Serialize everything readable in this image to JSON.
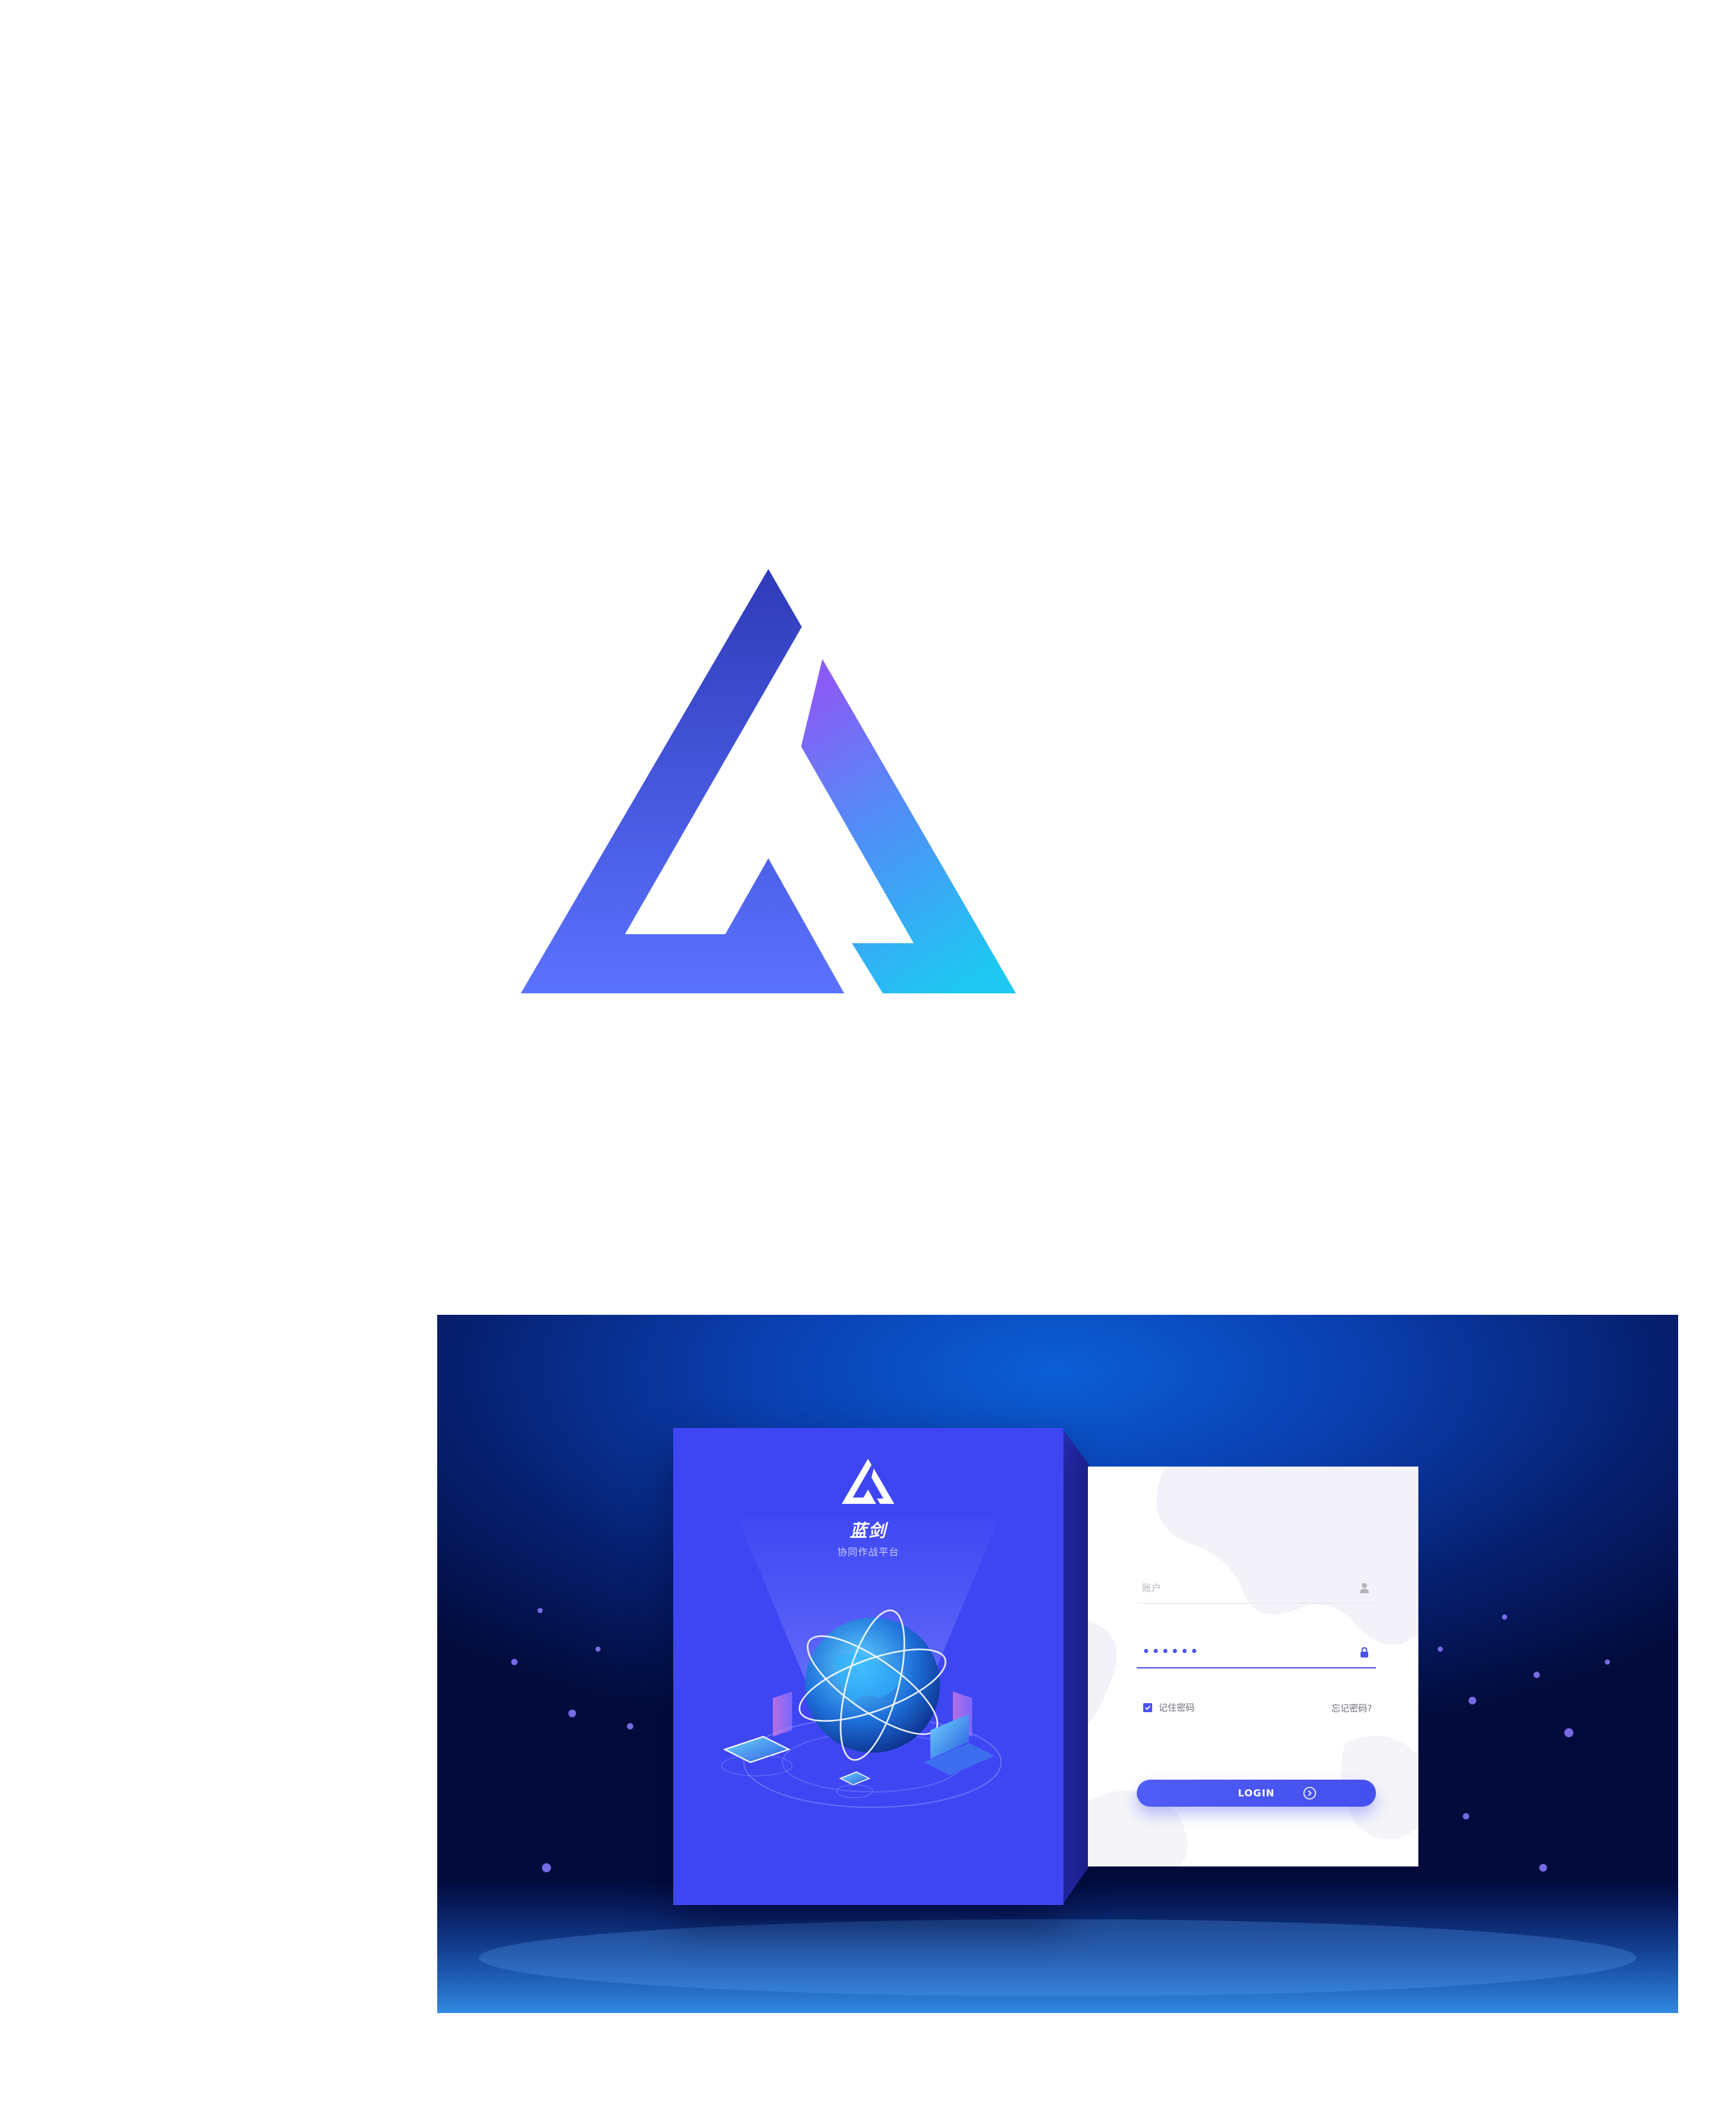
{
  "brand": {
    "name": "蓝剑",
    "tagline": "协同作战平台"
  },
  "colors": {
    "brand_primary": "#3e46f3",
    "logo_gradient_dark": "#2f3bb8",
    "logo_gradient_light": "#5b72ff",
    "logo_accent_top": "#8a5cf6",
    "logo_accent_bottom": "#1ec8f2",
    "screen_background": "#061f6e",
    "button": "#4a52ee"
  },
  "login": {
    "account_placeholder": "账户",
    "password_masked": "••••••",
    "remember_label": "记住密码",
    "remember_checked": true,
    "forgot_label": "忘记密码?",
    "submit_label": "LOGIN"
  },
  "icons": {
    "account": "user-icon",
    "password": "lock-icon",
    "remember": "check-icon",
    "submit": "arrow-right-circle-icon"
  }
}
